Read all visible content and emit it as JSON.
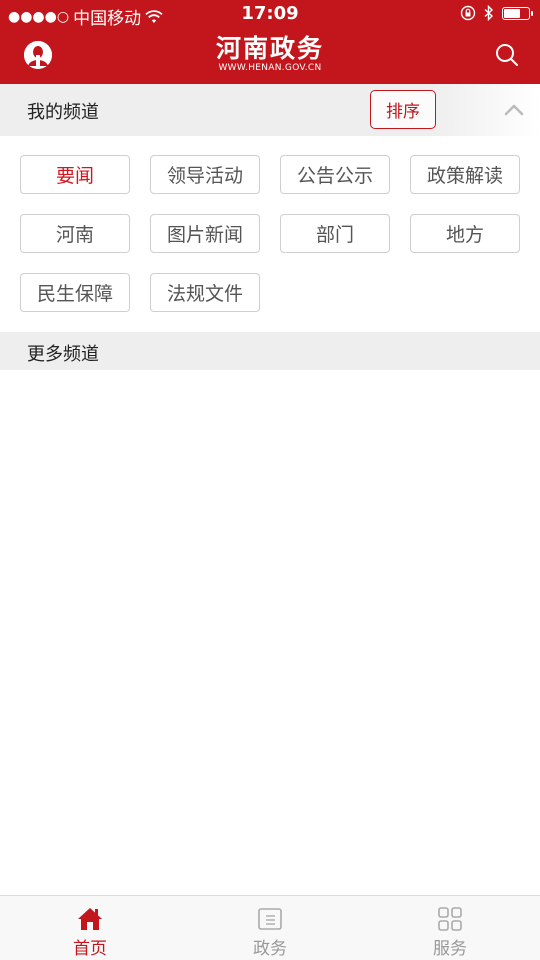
{
  "status_bar": {
    "signal_dots": "●●●●○",
    "carrier": "中国移动",
    "time": "17:09",
    "battery_level": 0.7
  },
  "header": {
    "title": "河南政务",
    "subtitle": "WWW.HENAN.GOV.CN",
    "left_icon": "user-avatar-icon",
    "right_icon": "search-icon"
  },
  "my_channels": {
    "title": "我的频道",
    "sort_label": "排序",
    "collapse_icon": "chevron-up-icon",
    "items": [
      {
        "label": "要闻",
        "active": true
      },
      {
        "label": "领导活动",
        "active": false
      },
      {
        "label": "公告公示",
        "active": false
      },
      {
        "label": "政策解读",
        "active": false
      },
      {
        "label": "河南",
        "active": false
      },
      {
        "label": "图片新闻",
        "active": false
      },
      {
        "label": "部门",
        "active": false
      },
      {
        "label": "地方",
        "active": false
      },
      {
        "label": "民生保障",
        "active": false
      },
      {
        "label": "法规文件",
        "active": false
      }
    ]
  },
  "more_channels": {
    "title": "更多频道"
  },
  "tab_bar": {
    "tabs": [
      {
        "label": "首页",
        "icon": "home-icon",
        "active": true
      },
      {
        "label": "政务",
        "icon": "document-icon",
        "active": false
      },
      {
        "label": "服务",
        "icon": "grid-icon",
        "active": false
      }
    ]
  },
  "colors": {
    "brand_red": "#c3161c",
    "active_text": "#d4161c",
    "inactive_tab": "#999999"
  }
}
